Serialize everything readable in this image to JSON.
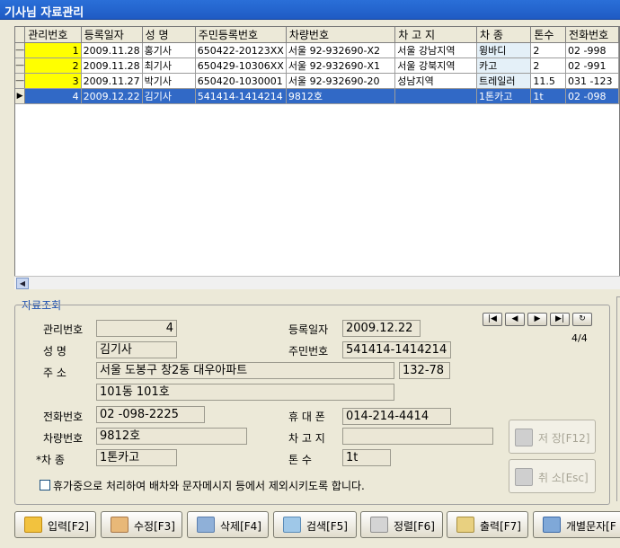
{
  "window": {
    "title": "기사님 자료관리"
  },
  "grid": {
    "headers": [
      "관리번호",
      "등록일자",
      "성  명",
      "주민등록번호",
      "차량번호",
      "차 고 지",
      "차  종",
      "톤수",
      "전화번호"
    ],
    "rows": [
      [
        "1",
        "2009.11.28",
        "홍기사",
        "650422-20123XX",
        "서울 92-932690-X2",
        "서울 강남지역",
        "윙바디",
        "2",
        "02  -998"
      ],
      [
        "2",
        "2009.11.28",
        "최기사",
        "650429-10306XX",
        "서울 92-932690-X1",
        "서울 강북지역",
        "카고",
        "2",
        "02  -991"
      ],
      [
        "3",
        "2009.11.27",
        "박기사",
        "650420-1030001",
        "서울 92-932690-20",
        "성남지역",
        "트레일러",
        "11.5",
        "031 -123"
      ],
      [
        "4",
        "2009.12.22",
        "김기사",
        "541414-1414214",
        "9812호",
        "",
        "1톤카고",
        "1t",
        "02  -098"
      ]
    ],
    "selected_row": 4
  },
  "detail": {
    "group_title": "자료조회",
    "labels": {
      "mgmt_no": "관리번호",
      "name": "성    명",
      "address": "주    소",
      "phone": "전화번호",
      "car_no": "차량번호",
      "car_type": "*차    종",
      "reg_date": "등록일자",
      "ssn": "주민번호",
      "mobile": "휴 대 폰",
      "garage": "차 고 지",
      "tonnage": "톤    수"
    },
    "values": {
      "mgmt_no": "4",
      "name": "김기사",
      "address1": "서울 도봉구 창2동 대우아파트",
      "zip": "132-78",
      "address2": "101동 101호",
      "phone": "02  -098-2225",
      "car_no": "9812호",
      "car_type": "1톤카고",
      "reg_date": "2009.12.22",
      "ssn": "541414-1414214",
      "mobile": "014-214-4414",
      "garage": "",
      "tonnage": "1t"
    },
    "nav": [
      "|◀",
      "◀",
      "▶",
      "▶|",
      "↻"
    ],
    "pager": "4/4",
    "save_label": "저 장[F12]",
    "cancel_label": "취 소[Esc]",
    "checkbox_label": "휴가중으로 처리하여 배차와 문자메시지 등에서 제외시키도록 합니다."
  },
  "toolbar": {
    "buttons": [
      "입력[F2]",
      "수정[F3]",
      "삭제[F4]",
      "검색[F5]",
      "정렬[F6]",
      "출력[F7]",
      "개별문자[F"
    ]
  },
  "colors": {
    "title_bar": "#2a6fd8",
    "selected_row": "#3169c6",
    "mgmt_cell": "#ffff00"
  }
}
